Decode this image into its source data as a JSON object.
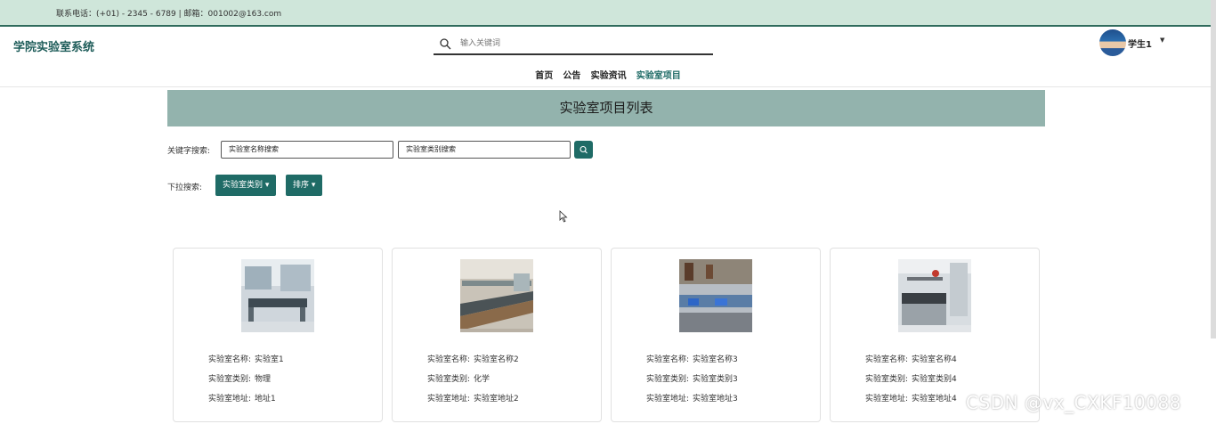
{
  "topbar": {
    "contact": "联系电话：(+01) - 2345 - 6789 | 邮箱：001002@163.com"
  },
  "header": {
    "logo": "学院实验室系统",
    "search_placeholder": "输入关键词",
    "user": "学生1",
    "nav": [
      "首页",
      "公告",
      "实验资讯",
      "实验室项目"
    ],
    "active_nav": "实验室项目"
  },
  "page": {
    "title": "实验室项目列表",
    "keyword_label": "关键字搜索:",
    "name_search": "实验室名称搜索",
    "type_search": "实验室类别搜索",
    "dropdown_label": "下拉搜索:",
    "type_dropdown": "实验室类别",
    "sort_dropdown": "排序"
  },
  "cards": [
    {
      "name_label": "实验室名称:",
      "name": "实验室1",
      "type_label": "实验室类别:",
      "type": "物理",
      "addr_label": "实验室地址:",
      "addr": "地址1"
    },
    {
      "name_label": "实验室名称:",
      "name": "实验室名称2",
      "type_label": "实验室类别:",
      "type": "化学",
      "addr_label": "实验室地址:",
      "addr": "实验室地址2"
    },
    {
      "name_label": "实验室名称:",
      "name": "实验室名称3",
      "type_label": "实验室类别:",
      "type": "实验室类别3",
      "addr_label": "实验室地址:",
      "addr": "实验室地址3"
    },
    {
      "name_label": "实验室名称:",
      "name": "实验室名称4",
      "type_label": "实验室类别:",
      "type": "实验室类别4",
      "addr_label": "实验室地址:",
      "addr": "实验室地址4"
    }
  ],
  "watermark": "CSDN @vx_CXKF10088",
  "colors": {
    "accent": "#1f6b66",
    "banner": "#93b3ad",
    "topbar": "#cfe6da"
  }
}
